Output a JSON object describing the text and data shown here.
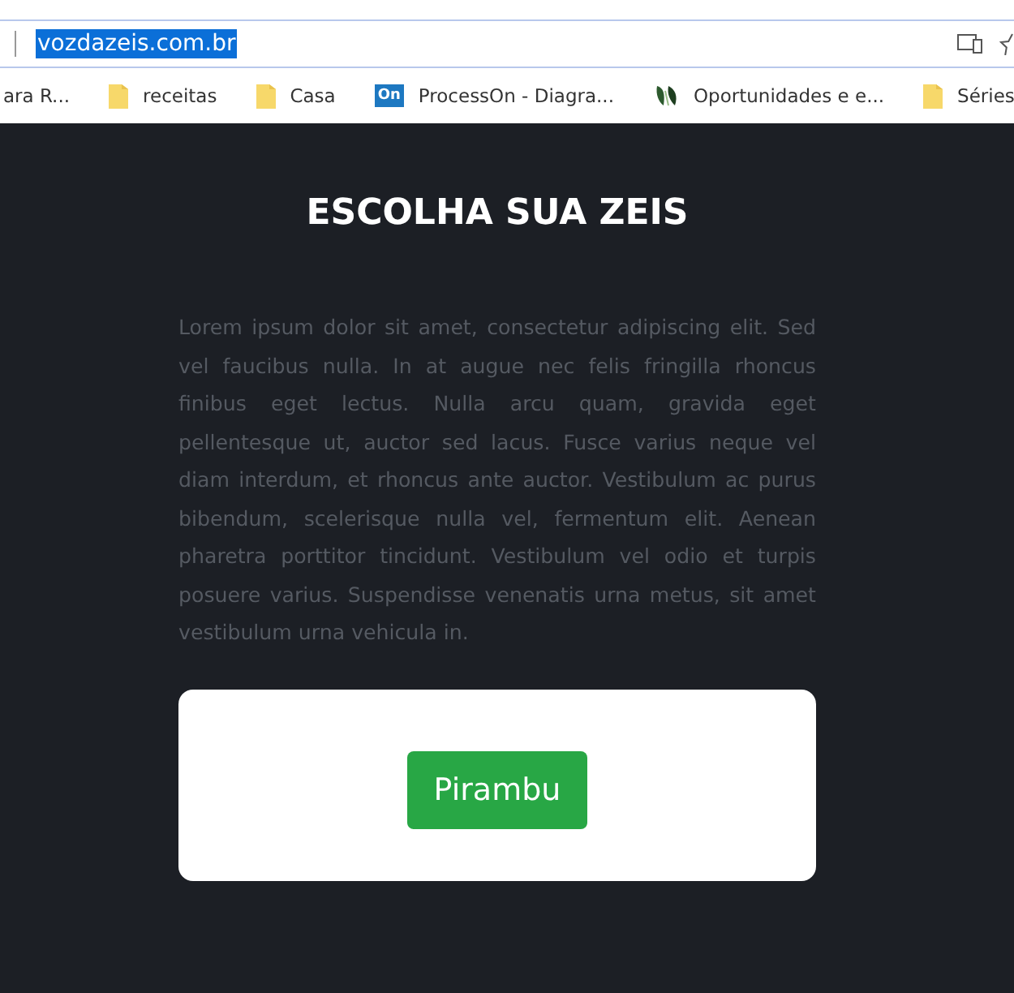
{
  "address_bar": {
    "url": "vozdazeis.com.br",
    "selected": true
  },
  "bookmarks": [
    {
      "label": "ara R...",
      "kind": "none"
    },
    {
      "label": "receitas",
      "kind": "folder"
    },
    {
      "label": "Casa",
      "kind": "folder"
    },
    {
      "label": "ProcessOn - Diagra...",
      "kind": "processon",
      "icon_text": "On"
    },
    {
      "label": "Oportunidades e e...",
      "kind": "plant"
    },
    {
      "label": "Séries",
      "kind": "folder"
    }
  ],
  "page": {
    "title": "ESCOLHA SUA ZEIS",
    "paragraph": "Lorem ipsum dolor sit amet, consectetur adipiscing elit. Sed vel faucibus nulla. In at augue nec felis fringilla rhoncus finibus eget lectus. Nulla arcu quam, gravida eget pellentesque ut, auctor sed lacus. Fusce varius neque vel diam interdum, et rhoncus ante auctor. Vestibulum ac purus bibendum, scelerisque nulla vel, fermentum elit. Aenean pharetra porttitor tincidunt. Vestibulum vel odio et turpis posuere varius. Suspendisse venenatis urna metus, sit amet vestibulum urna vehicula in.",
    "buttons": [
      "Pirambu"
    ]
  }
}
